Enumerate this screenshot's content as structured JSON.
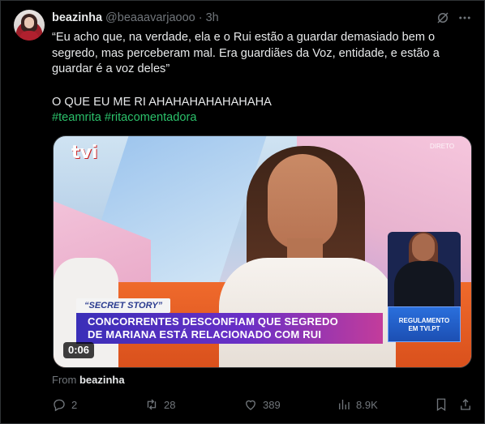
{
  "tweet": {
    "name": "beazinha",
    "handle": "@beaaavarjaooo",
    "separator": "·",
    "time": "3h",
    "text": "“Eu acho que, na verdade, ela e o Rui estão a guardar demasiado bem o segredo, mas perceberam mal. Era guardiães da Voz, entidade, e estão a guardar é a voz deles”",
    "laugh": "O QUE EU ME RI AHAHAHAHAHAHAHA",
    "hashtags": [
      "#teamrita",
      "#ritacomentadora"
    ],
    "from_prefix": "From",
    "from_name": "beazinha"
  },
  "media": {
    "tag": "“SECRET STORY”",
    "headline_line1": "CONCORRENTES DESCONFIAM QUE SEGREDO",
    "headline_line2": "DE MARIANA ESTÁ RELACIONADO COM RUI",
    "reg_line1": "REGULAMENTO",
    "reg_line2": "EM TVI.PT",
    "duration": "0:06",
    "logo_text": "tvi",
    "live_badge": "DIRETO"
  },
  "actions": {
    "replies": "2",
    "retweets": "28",
    "likes": "389",
    "views": "8.9K"
  },
  "icons": {
    "grok": "grok-icon",
    "more": "more-icon",
    "reply": "reply-icon",
    "retweet": "retweet-icon",
    "like": "heart-icon",
    "views": "views-icon",
    "bookmark": "bookmark-icon",
    "share": "share-icon"
  },
  "colors": {
    "background": "#000000",
    "text": "#e7e9ea",
    "muted": "#71767b",
    "hashtag": "#2bc06a"
  }
}
